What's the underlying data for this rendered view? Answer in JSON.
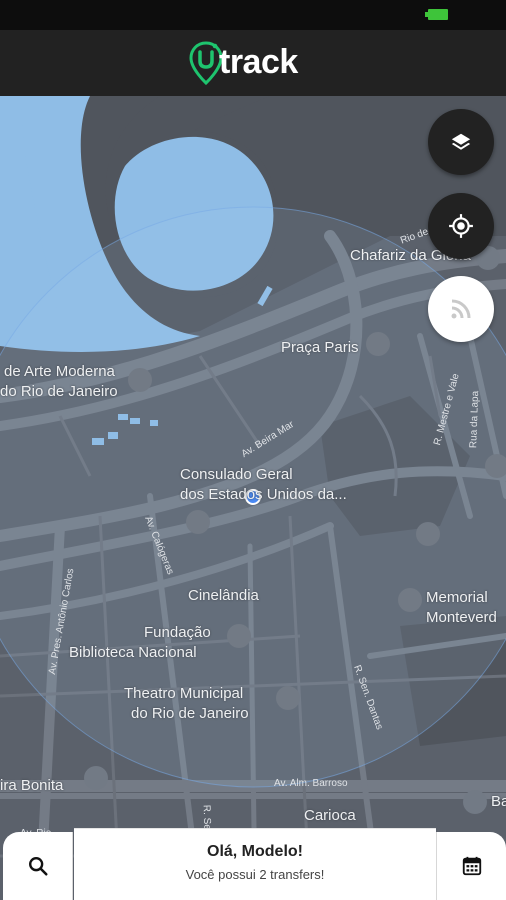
{
  "app": {
    "title": "track"
  },
  "colors": {
    "accent": "#1ec46e",
    "header": "#222222",
    "map_bg": "#5b616b",
    "water": "#8fbde6"
  },
  "map": {
    "labels": {
      "chafariz": "Chafariz da Glória",
      "praca_paris": "Praça Paris",
      "museu_1": "de Arte Moderna",
      "museu_2": "do Rio de Janeiro",
      "consulado_1": "Consulado Geral",
      "consulado_2": "dos Estados Unidos da...",
      "cinelandia": "Cinelândia",
      "fundacao_1": "Fundação",
      "fundacao_2": "Biblioteca Nacional",
      "theatro_1": "Theatro Municipal",
      "theatro_2": "do Rio de Janeiro",
      "memorial_1": "Memorial",
      "memorial_2": "Monteverd",
      "bonita": "ira Bonita",
      "carioca": "Carioca",
      "ba": "Ba"
    },
    "streets": {
      "beira_mar": "Av. Beira Mar",
      "calogeras": "Av. Calógeras",
      "antonio_carlos": "Av. Pres. Antônio Carlos",
      "senador_dantas": "R. Sen. Dantas",
      "barroso": "Av. Alm. Barroso",
      "mestre_valentim": "R. Mestre e Vale",
      "lapa": "Rua da Lapa",
      "rio_branco": "Rio de",
      "bottom_a": "R. Sete",
      "bottom_b": "Av. Rio"
    }
  },
  "controls": {
    "layers_icon": "layers-icon",
    "locate_icon": "my-location-icon",
    "signal_icon": "rss-feed-icon"
  },
  "bottom": {
    "search_icon": "search-icon",
    "greeting": "Olá, Modelo!",
    "transfers": "Você possui 2 transfers!",
    "calendar_icon": "calendar-icon"
  }
}
